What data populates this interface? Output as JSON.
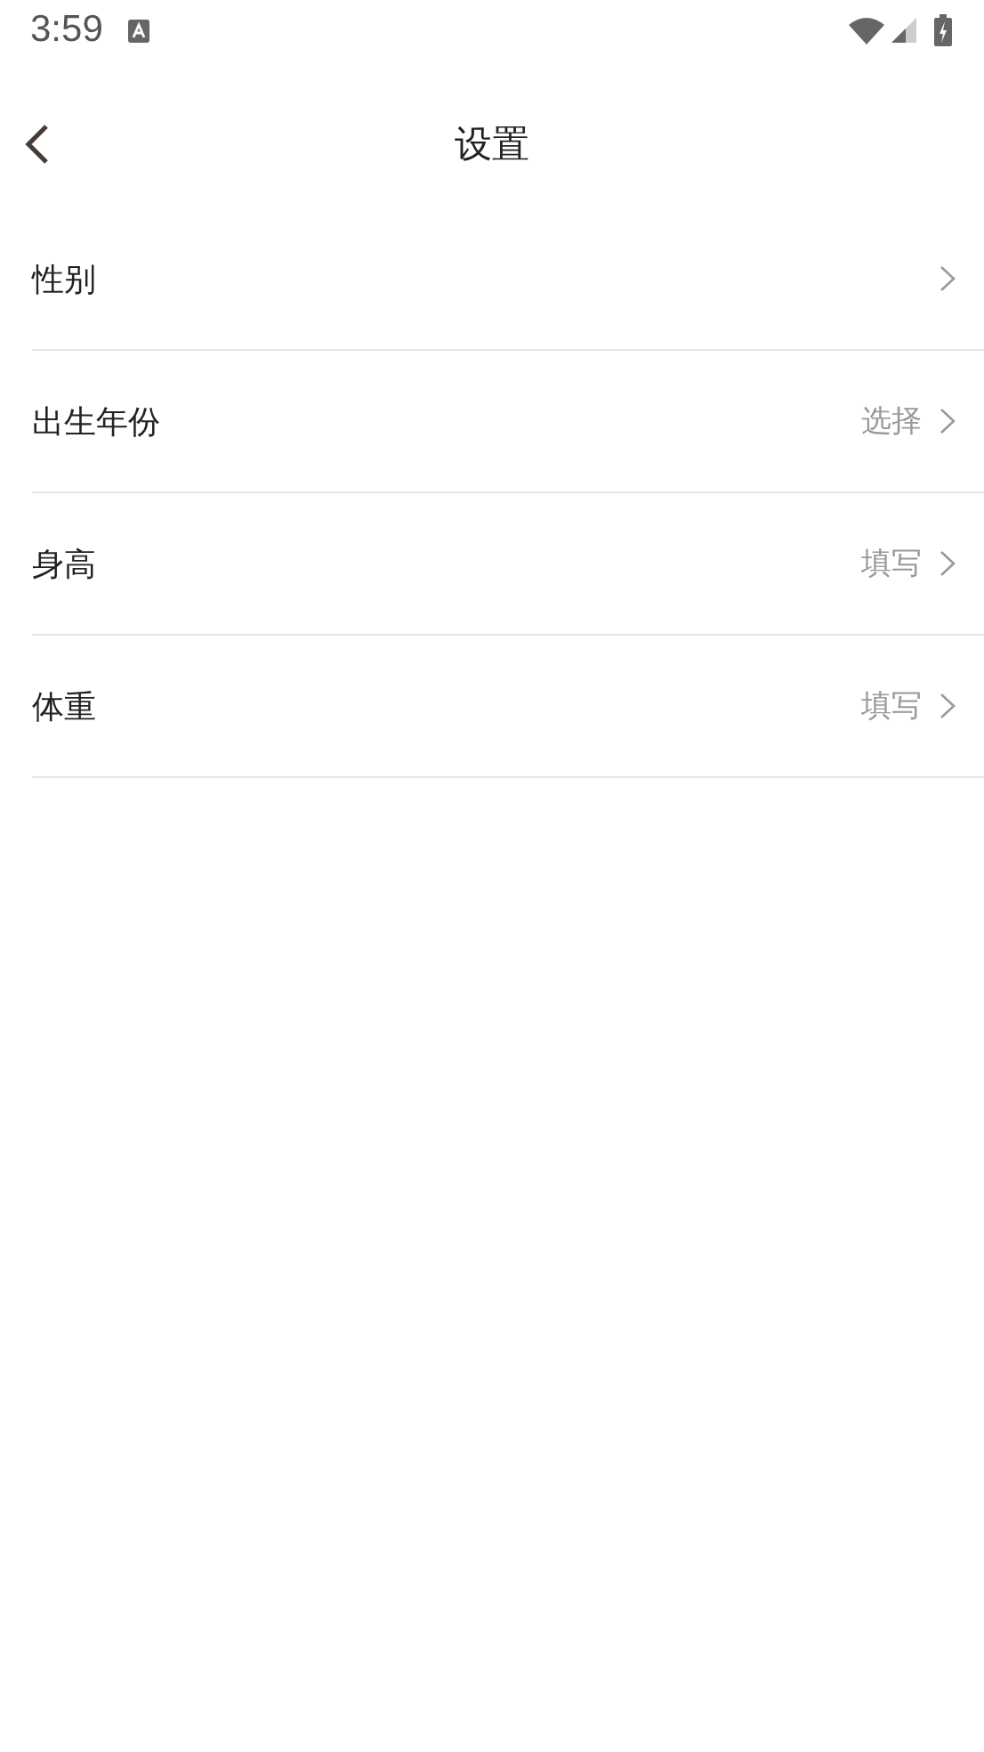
{
  "status_bar": {
    "time": "3:59"
  },
  "header": {
    "title": "设置"
  },
  "settings": [
    {
      "label": "性别"
    },
    {
      "label": "出生年份",
      "value": "选择"
    },
    {
      "label": "身高",
      "value": "填写"
    },
    {
      "label": "体重",
      "value": "填写"
    }
  ]
}
